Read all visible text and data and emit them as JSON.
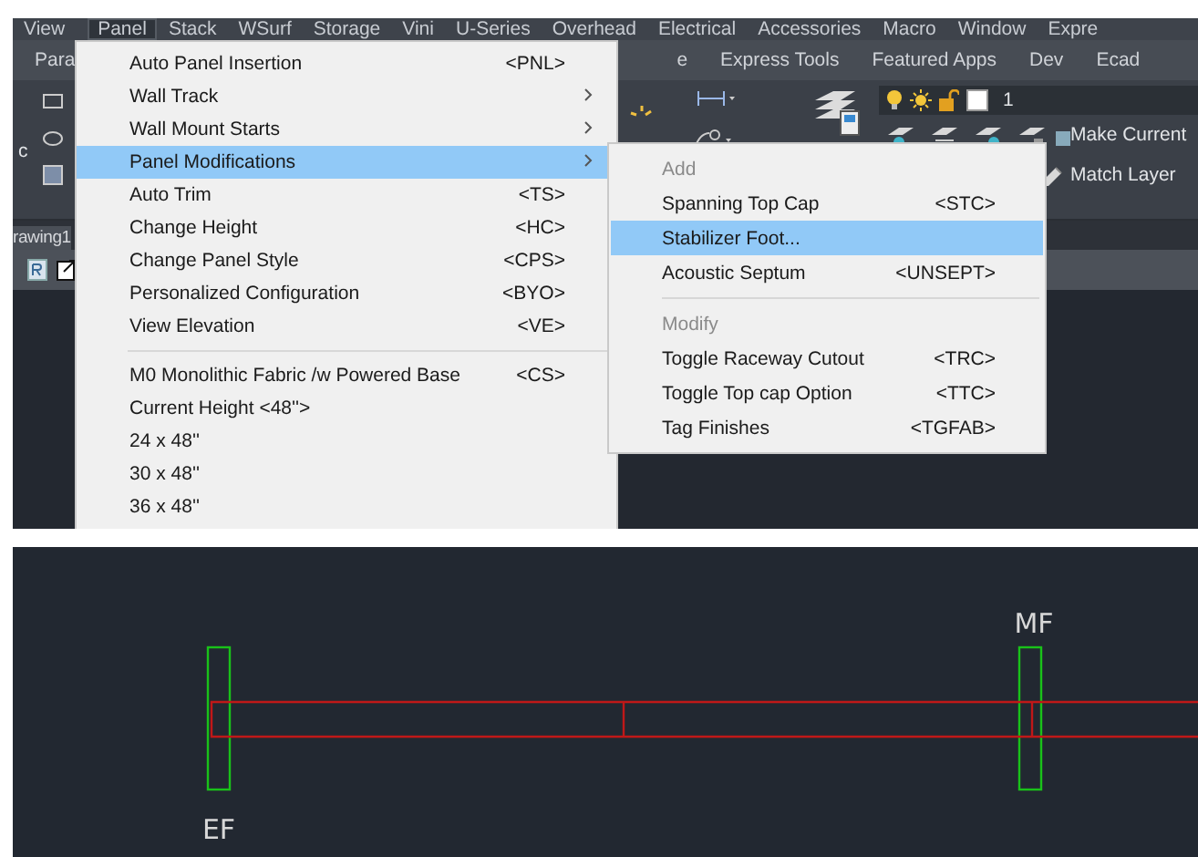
{
  "menubar": [
    {
      "label": "View",
      "selected": false
    },
    {
      "label": "Panel",
      "selected": true
    },
    {
      "label": "Stack",
      "selected": false
    },
    {
      "label": "WSurf",
      "selected": false
    },
    {
      "label": "Storage",
      "selected": false
    },
    {
      "label": "Vini",
      "selected": false
    },
    {
      "label": "U-Series",
      "selected": false
    },
    {
      "label": "Overhead",
      "selected": false
    },
    {
      "label": "Electrical",
      "selected": false
    },
    {
      "label": "Accessories",
      "selected": false
    },
    {
      "label": "Macro",
      "selected": false
    },
    {
      "label": "Window",
      "selected": false
    },
    {
      "label": "Expre",
      "selected": false
    }
  ],
  "ribbon_tabs_left": [
    {
      "label": "Para"
    }
  ],
  "ribbon_tabs_right": [
    {
      "label": "e"
    },
    {
      "label": "Express Tools"
    },
    {
      "label": "Featured Apps"
    },
    {
      "label": "Dev"
    },
    {
      "label": "Ecad"
    }
  ],
  "ribbon": {
    "left_label": "c",
    "layer_name": "1",
    "buttons": [
      "Make Current",
      "Match Layer"
    ]
  },
  "document_tab": {
    "label": "rawing1"
  },
  "menu": {
    "items": [
      {
        "kind": "item",
        "label": "Auto Panel Insertion",
        "shortcut": "<PNL>",
        "submenu": false,
        "selected": false
      },
      {
        "kind": "item",
        "label": "Wall Track",
        "submenu": true,
        "selected": false
      },
      {
        "kind": "item",
        "label": "Wall Mount Starts",
        "submenu": true,
        "selected": false
      },
      {
        "kind": "item",
        "label": "Panel Modifications",
        "submenu": true,
        "selected": true
      },
      {
        "kind": "item",
        "label": "Auto Trim",
        "shortcut": "<TS>",
        "submenu": false,
        "selected": false
      },
      {
        "kind": "item",
        "label": "Change Height",
        "shortcut": "<HC>",
        "submenu": false,
        "selected": false
      },
      {
        "kind": "item",
        "label": "Change Panel Style",
        "shortcut": "<CPS>",
        "submenu": false,
        "selected": false
      },
      {
        "kind": "item",
        "label": "Personalized Configuration",
        "shortcut": "<BYO>",
        "submenu": false,
        "selected": false
      },
      {
        "kind": "item",
        "label": "View Elevation",
        "shortcut": "<VE>",
        "submenu": false,
        "selected": false
      },
      {
        "kind": "separator"
      },
      {
        "kind": "item",
        "label": "M0 Monolithic Fabric /w Powered Base",
        "shortcut": "<CS>",
        "submenu": false,
        "selected": false
      },
      {
        "kind": "item",
        "label": "Current Height <48''>",
        "submenu": false,
        "selected": false
      },
      {
        "kind": "item",
        "label": "24 x 48''",
        "submenu": false,
        "selected": false
      },
      {
        "kind": "item",
        "label": "30 x 48''",
        "submenu": false,
        "selected": false
      },
      {
        "kind": "item",
        "label": "36 x 48''",
        "submenu": false,
        "selected": false
      }
    ]
  },
  "submenu": {
    "items": [
      {
        "kind": "header",
        "label": "Add"
      },
      {
        "kind": "item",
        "label": "Spanning Top Cap",
        "shortcut": "<STC>",
        "selected": false
      },
      {
        "kind": "item",
        "label": "Stabilizer Foot...",
        "selected": true
      },
      {
        "kind": "item",
        "label": "Acoustic Septum",
        "shortcut": "<UNSEPT>",
        "selected": false
      },
      {
        "kind": "separator"
      },
      {
        "kind": "header",
        "label": "Modify"
      },
      {
        "kind": "item",
        "label": "Toggle Raceway Cutout",
        "shortcut": "<TRC>",
        "selected": false
      },
      {
        "kind": "item",
        "label": "Toggle Top cap Option",
        "shortcut": "<TTC>",
        "selected": false
      },
      {
        "kind": "item",
        "label": "Tag Finishes",
        "shortcut": "<TGFAB>",
        "selected": false
      }
    ]
  },
  "canvas": {
    "labels": [
      {
        "text": "EF",
        "kind": "end-foot"
      },
      {
        "text": "MF",
        "kind": "mid-foot"
      }
    ]
  }
}
